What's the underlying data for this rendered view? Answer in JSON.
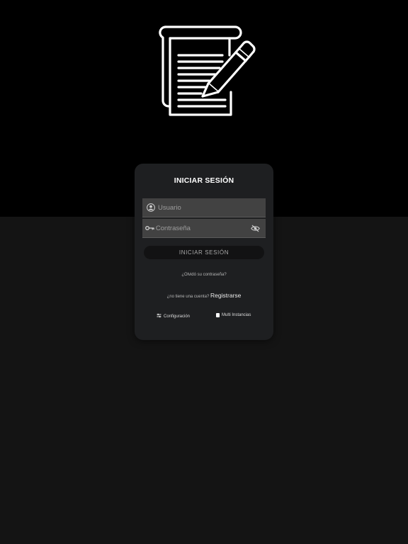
{
  "login": {
    "title": "INICIAR SESIÓN",
    "username_placeholder": "Usuario",
    "password_placeholder": "Contraseña",
    "submit_label": "INICIAR SESIÓN",
    "forgot_label": "¿Olvidó su contraseña?",
    "no_account_text": "¿no tiene una cuenta?",
    "register_label": "Registrarse",
    "config_label": "Configuración",
    "multi_instances_label": "Multi Instancias"
  },
  "icons": {
    "logo": "notepad-pencil-icon",
    "user": "user-icon",
    "key": "key-icon",
    "visibility": "eye-off-icon",
    "config": "settings-icon",
    "checkbox": "checkbox-icon"
  }
}
